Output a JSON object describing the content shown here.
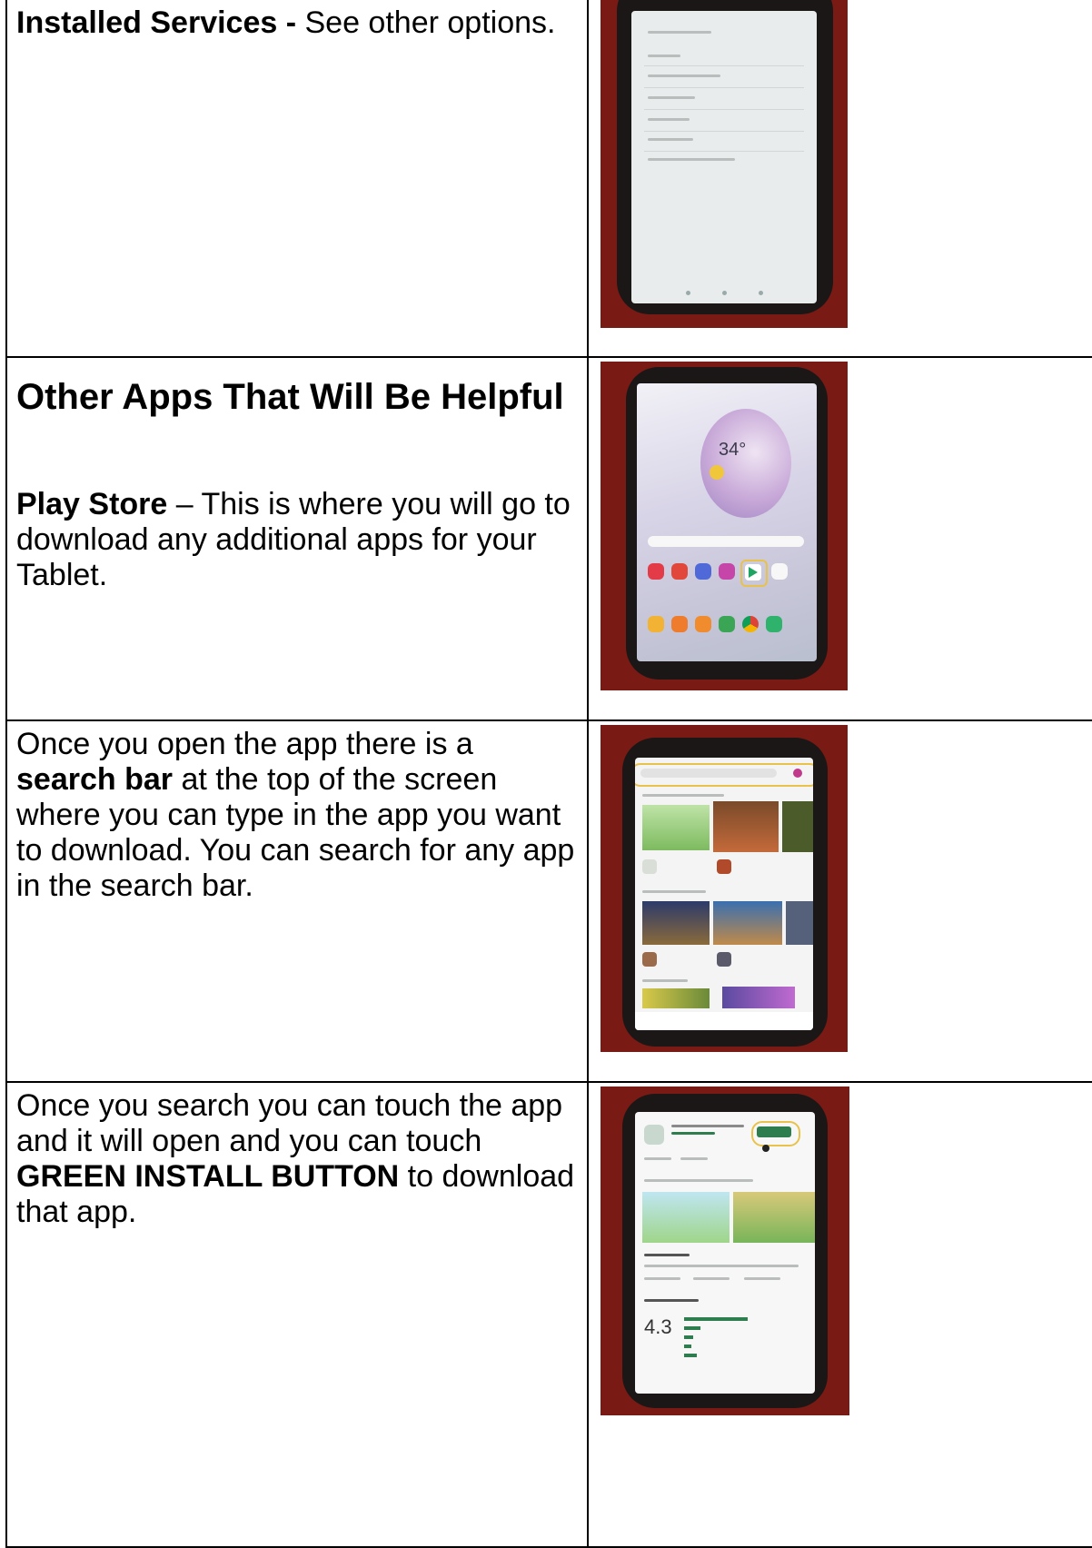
{
  "rows": [
    {
      "lead": "Installed Services -",
      "text": " See other options.",
      "photo_icon": "tablet-installed-services-photo-icon"
    },
    {
      "heading": "Other Apps That Will Be Helpful",
      "lead": "Play Store",
      "text": " – This is where you will go to download any additional apps for your Tablet.",
      "photo_icon": "tablet-home-screen-photo-icon",
      "weather_temp": "34°"
    },
    {
      "text_before": "Once you open the app there is a ",
      "lead": "search bar",
      "text": " at the top of the screen where you can type in the app you want to download. You can search for any app in the search bar.",
      "photo_icon": "tablet-play-store-search-photo-icon"
    },
    {
      "text_before": "Once you search you can touch the app and it will open and you can touch ",
      "lead": "GREEN INSTALL BUTTON",
      "text": " to download that app.",
      "photo_icon": "tablet-app-install-photo-icon",
      "rating": "4.3"
    }
  ],
  "colors": {
    "background_red": "#7a1a14",
    "tablet_case": "#1b1716",
    "highlight_yellow": "#e8c24a",
    "install_green": "#2e7d4f"
  }
}
